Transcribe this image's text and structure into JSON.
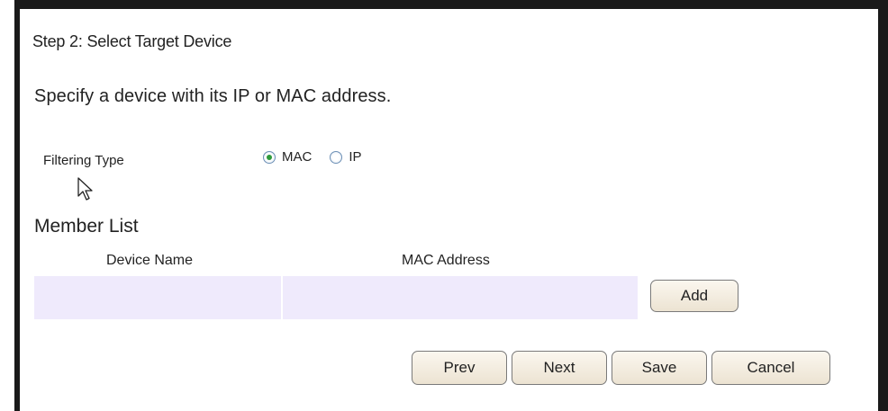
{
  "step": {
    "title": "Step 2: Select Target Device",
    "description": "Specify a device with its IP or MAC address."
  },
  "filtering": {
    "label": "Filtering Type",
    "options": [
      {
        "label": "MAC",
        "selected": true
      },
      {
        "label": "IP",
        "selected": false
      }
    ]
  },
  "member_list": {
    "title": "Member List",
    "columns": [
      "Device Name",
      "MAC Address"
    ],
    "rows": [
      {
        "device_name": "",
        "mac_address": ""
      }
    ],
    "add_label": "Add"
  },
  "actions": {
    "prev": "Prev",
    "next": "Next",
    "save": "Save",
    "cancel": "Cancel"
  },
  "colors": {
    "border": "#1a1a1a",
    "row_bg": "#efeafc",
    "radio_selected": "#2f9a3c",
    "button_bg": "#f5efe2"
  },
  "icons": {
    "cursor": "mouse-pointer-icon"
  }
}
